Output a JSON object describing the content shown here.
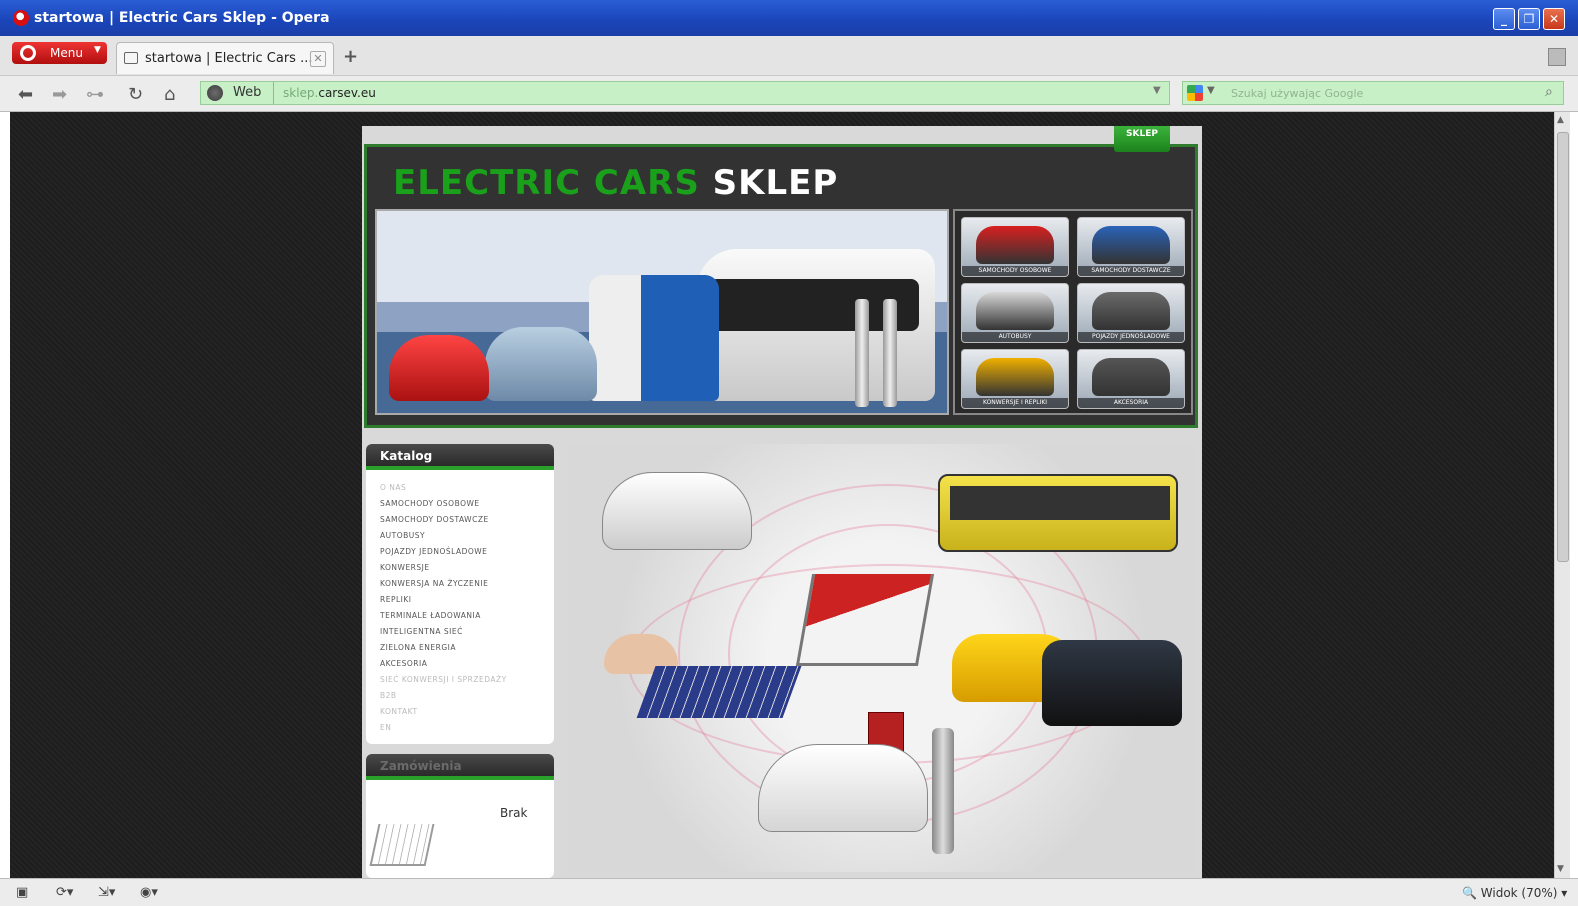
{
  "window": {
    "title": "startowa | Electric Cars Sklep - Opera"
  },
  "browser": {
    "menu_label": "Menu",
    "tab_title": "startowa | Electric Cars ...",
    "address_mode": "Web",
    "url_subdomain": "sklep.",
    "url_domain": "carsev.eu",
    "search_placeholder": "Szukaj używając Google",
    "zoom_label": "Widok (70%)"
  },
  "site": {
    "top_tab": "SKLEP",
    "logo_part1": "ELECTRIC CARS",
    "logo_part2": "SKLEP",
    "categories_grid": [
      {
        "label": "SAMOCHODY OSOBOWE",
        "color": "#d82020"
      },
      {
        "label": "SAMOCHODY DOSTAWCZE",
        "color": "#2a63b8"
      },
      {
        "label": "AUTOBUSY",
        "color": "#d8d8d8"
      },
      {
        "label": "POJAZDY JEDNOŚLADOWE",
        "color": "#6a6a6a"
      },
      {
        "label": "KONWERSJE I REPLIKI",
        "color": "#f0b000"
      },
      {
        "label": "AKCESORIA",
        "color": "#555555"
      }
    ],
    "sidebar": {
      "heading": "Katalog",
      "items": [
        {
          "label": "O NAS",
          "dim": true
        },
        {
          "label": "SAMOCHODY OSOBOWE",
          "dim": false
        },
        {
          "label": "SAMOCHODY DOSTAWCZE",
          "dim": false
        },
        {
          "label": "AUTOBUSY",
          "dim": false
        },
        {
          "label": "POJAZDY JEDNOŚLADOWE",
          "dim": false
        },
        {
          "label": "KONWERSJE",
          "dim": false
        },
        {
          "label": "KONWERSJA NA ŻYCZENIE",
          "dim": false
        },
        {
          "label": "REPLIKI",
          "dim": false
        },
        {
          "label": "TERMINALE ŁADOWANIA",
          "dim": false
        },
        {
          "label": "INTELIGENTNA SIEĆ",
          "dim": false
        },
        {
          "label": "ZIELONA ENERGIA",
          "dim": false
        },
        {
          "label": "AKCESORIA",
          "dim": false
        },
        {
          "label": "SIEĆ KONWERSJI I SPRZEDAŻY",
          "dim": true
        },
        {
          "label": "B2B",
          "dim": true
        },
        {
          "label": "KONTAKT",
          "dim": true
        },
        {
          "label": "EN",
          "dim": true
        }
      ]
    },
    "cart": {
      "heading": "Zamówienia",
      "status": "Brak"
    }
  },
  "colors": {
    "brand_green": "#1aa01a",
    "title_bar": "#1a44b8",
    "address_bar": "#c7f0c7"
  }
}
